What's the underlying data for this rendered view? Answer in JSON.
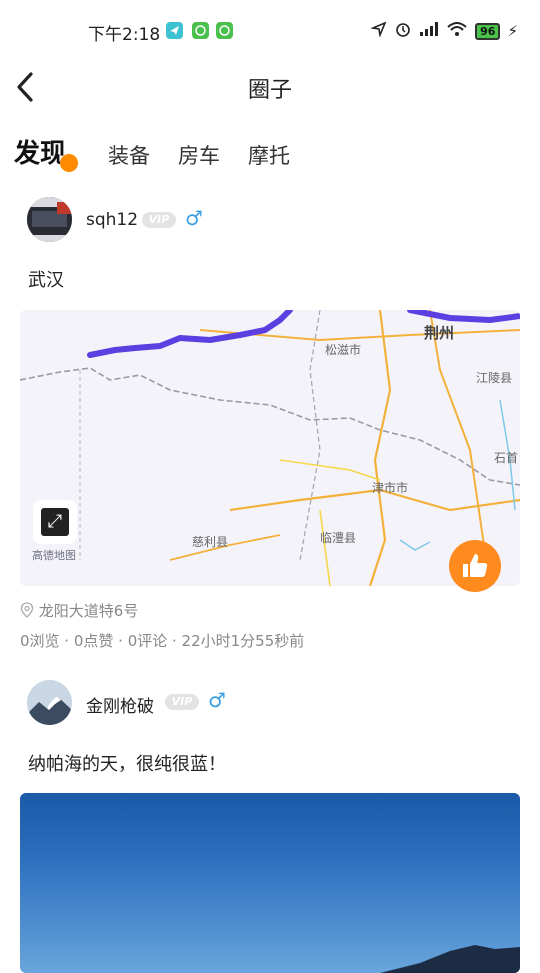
{
  "status_bar": {
    "time": "下午2:18",
    "battery": "96",
    "icons": [
      "send-icon",
      "wechat-icon",
      "wechat-icon",
      "location-arrow-icon",
      "alarm-icon",
      "signal-icon",
      "wifi-icon",
      "battery-icon",
      "charging-icon"
    ]
  },
  "nav": {
    "title": "圈子"
  },
  "tabs": [
    {
      "label": "发现",
      "active": true
    },
    {
      "label": "装备",
      "active": false
    },
    {
      "label": "房车",
      "active": false
    },
    {
      "label": "摩托",
      "active": false
    }
  ],
  "posts": [
    {
      "username": "sqh12",
      "vip": "VIP",
      "gender": "♂",
      "text": "武汉",
      "map_labels": [
        "荆州",
        "松滋市",
        "江陵县",
        "石首",
        "津市市",
        "临澧县",
        "慈利县",
        "高德地图"
      ],
      "location": "龙阳大道特6号",
      "meta": "0浏览 · 0点赞 · 0评论 · 22小时1分55秒前"
    },
    {
      "username": "金刚枪破",
      "vip": "VIP",
      "gender": "♂",
      "text": "纳帕海的天，很纯很蓝！"
    }
  ],
  "colors": {
    "accent": "#ff8a00",
    "gender": "#3a9fe0",
    "route": "#5b3fe0"
  }
}
